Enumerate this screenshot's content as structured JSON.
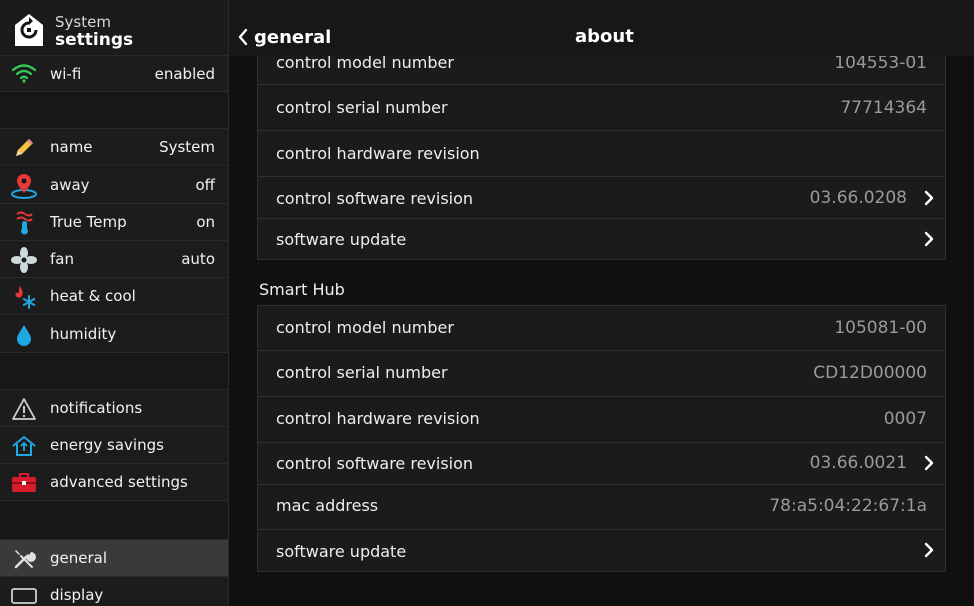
{
  "sidebar": {
    "title_line1": "System",
    "title_line2": "settings",
    "items": [
      {
        "icon": "wifi-icon",
        "label": "wi-fi",
        "value": "enabled"
      },
      {
        "icon": "pencil-icon",
        "label": "name",
        "value": "System"
      },
      {
        "icon": "location-pin-icon",
        "label": "away",
        "value": "off"
      },
      {
        "icon": "true-temp-icon",
        "label": "True Temp",
        "value": "on"
      },
      {
        "icon": "fan-icon",
        "label": "fan",
        "value": "auto"
      },
      {
        "icon": "heat-cool-icon",
        "label": "heat & cool",
        "value": ""
      },
      {
        "icon": "droplet-icon",
        "label": "humidity",
        "value": ""
      },
      {
        "icon": "warning-icon",
        "label": "notifications",
        "value": ""
      },
      {
        "icon": "home-energy-icon",
        "label": "energy savings",
        "value": ""
      },
      {
        "icon": "toolbox-icon",
        "label": "advanced settings",
        "value": ""
      },
      {
        "icon": "wrench-screwdriver-icon",
        "label": "general",
        "value": ""
      },
      {
        "icon": "display-icon",
        "label": "display",
        "value": ""
      }
    ]
  },
  "topbar": {
    "back_label": "general",
    "title": "about"
  },
  "control": {
    "rows": [
      {
        "label": "control model number",
        "value": "104553-01"
      },
      {
        "label": "control serial number",
        "value": "77714364"
      },
      {
        "label": "control hardware revision",
        "value": ""
      },
      {
        "label": "control software revision",
        "value": "03.66.0208"
      },
      {
        "label": "software update",
        "value": ""
      }
    ]
  },
  "smart_hub": {
    "title": "Smart Hub",
    "rows": [
      {
        "label": "control model number",
        "value": "105081-00"
      },
      {
        "label": "control serial number",
        "value": "CD12D00000"
      },
      {
        "label": "control hardware revision",
        "value": "0007"
      },
      {
        "label": "control software revision",
        "value": "03.66.0021"
      },
      {
        "label": "mac address",
        "value": "78:a5:04:22:67:1a"
      },
      {
        "label": "software update",
        "value": ""
      }
    ]
  },
  "colors": {
    "accent_blue": "#1ea7e0",
    "wifi_green": "#34c759",
    "heat_red": "#e53935",
    "toolbox_red": "#d81b2c"
  }
}
